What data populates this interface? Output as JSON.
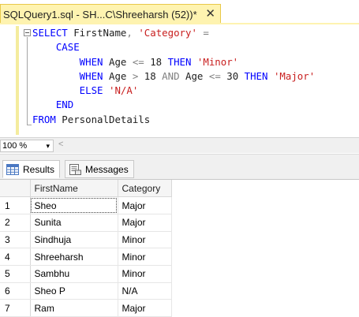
{
  "tab": {
    "title": "SQLQuery1.sql - SH...C\\Shreeharsh (52))*",
    "close_glyph": "✕"
  },
  "editor": {
    "lines": [
      [
        {
          "t": "SELECT",
          "c": "kw"
        },
        {
          "t": " FirstName",
          "c": "id"
        },
        {
          "t": ",",
          "c": "op"
        },
        {
          "t": " ",
          "c": "id"
        },
        {
          "t": "'Category'",
          "c": "str"
        },
        {
          "t": " ",
          "c": "id"
        },
        {
          "t": "=",
          "c": "op"
        }
      ],
      [
        {
          "t": "    CASE",
          "c": "kw"
        }
      ],
      [
        {
          "t": "        WHEN",
          "c": "kw"
        },
        {
          "t": " Age ",
          "c": "id"
        },
        {
          "t": "<=",
          "c": "op"
        },
        {
          "t": " 18 ",
          "c": "id"
        },
        {
          "t": "THEN",
          "c": "kw"
        },
        {
          "t": " ",
          "c": "id"
        },
        {
          "t": "'Minor'",
          "c": "str"
        }
      ],
      [
        {
          "t": "        WHEN",
          "c": "kw"
        },
        {
          "t": " Age ",
          "c": "id"
        },
        {
          "t": ">",
          "c": "op"
        },
        {
          "t": " 18 ",
          "c": "id"
        },
        {
          "t": "AND",
          "c": "op"
        },
        {
          "t": " Age ",
          "c": "id"
        },
        {
          "t": "<=",
          "c": "op"
        },
        {
          "t": " 30 ",
          "c": "id"
        },
        {
          "t": "THEN",
          "c": "kw"
        },
        {
          "t": " ",
          "c": "id"
        },
        {
          "t": "'Major'",
          "c": "str"
        }
      ],
      [
        {
          "t": "        ELSE",
          "c": "kw"
        },
        {
          "t": " ",
          "c": "id"
        },
        {
          "t": "'N/A'",
          "c": "str"
        }
      ],
      [
        {
          "t": "    END",
          "c": "kw"
        }
      ],
      [
        {
          "t": "FROM",
          "c": "kw"
        },
        {
          "t": " PersonalDetails",
          "c": "id"
        }
      ]
    ]
  },
  "zoom": {
    "value": "100 %",
    "arrow_glyph": "▾",
    "scroll_glyph": "<"
  },
  "result_tabs": [
    {
      "label": "Results",
      "icon": "grid-icon",
      "active": true
    },
    {
      "label": "Messages",
      "icon": "messages-icon",
      "active": false
    }
  ],
  "grid": {
    "columns": [
      "FirstName",
      "Category"
    ],
    "rows": [
      {
        "n": "1",
        "first": "Sheo",
        "category": "Major"
      },
      {
        "n": "2",
        "first": "Sunita",
        "category": "Major"
      },
      {
        "n": "3",
        "first": "Sindhuja",
        "category": "Minor"
      },
      {
        "n": "4",
        "first": "Shreeharsh",
        "category": "Minor"
      },
      {
        "n": "5",
        "first": "Sambhu",
        "category": "Minor"
      },
      {
        "n": "6",
        "first": "Sheo P",
        "category": "N/A"
      },
      {
        "n": "7",
        "first": "Ram",
        "category": "Major"
      }
    ]
  },
  "colors": {
    "keyword": "#0000ff",
    "string": "#c81e1e",
    "operator": "#808080",
    "tab_active": "#fef3b0"
  }
}
